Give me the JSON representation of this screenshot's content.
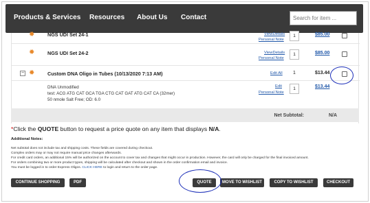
{
  "nav": {
    "items": [
      "Products & Services",
      "Resources",
      "About Us",
      "Contact"
    ],
    "search_placeholder": "Search for item ..."
  },
  "cart": {
    "rows": [
      {
        "name": "NGS UDI Set 24-1",
        "view": "ViewDetails",
        "note": "Personal Note",
        "qty": "1",
        "price": "$85.00"
      },
      {
        "name": "NGS UDI Set 24-2",
        "view": "ViewDetails",
        "note": "Personal Note",
        "qty": "1",
        "price": "$85.00"
      },
      {
        "name": "Custom DNA Oligo in Tubes (10/13/2020 7:13 AM)",
        "edit_all": "Edit All",
        "qty": "1",
        "price": "$13.44"
      }
    ],
    "oligo": {
      "type": "DNA Unmodified",
      "sequence": "test: ACG ATG CAT GCA TGA CTG CAT GAT ATG CAT CA (32mer)",
      "scale": "50 nmole  Salt Free;  OD: 6.0",
      "edit": "Edit",
      "note": "Personal Note",
      "qty": "1",
      "price": "$13.44"
    },
    "net_subtotal_label": "Net Subtotal:",
    "net_subtotal_value": "N/A"
  },
  "quote_note": {
    "star": "*",
    "before": "Click the ",
    "quote": "QUOTE",
    "middle": " button to request a price quote on any item that displays ",
    "na": "N/A",
    "after": "."
  },
  "additional_notes": {
    "title": "Additional Notes:",
    "lines": [
      "Net subtotal does not include tax and shipping costs. These fields are covered during checkout.",
      "Complex orders may or may not require manual price changes afterwards.",
      "For credit card orders, an additional 15% will be authorized on the account to cover tax and changes that might occur in production. However, the card will only be charged for the final invoiced amount.",
      "For orders combining two or more product types, shipping will be calculated after checkout and shown in the order confirmation email and invoice."
    ],
    "last_before": "You must be logged in to order Express Oligos. ",
    "last_link": "CLICK HERE",
    "last_after": " to login and return to the order page."
  },
  "buttons": {
    "continue": "CONTINUE SHOPPING",
    "pdf": "PDF",
    "quote": "QUOTE",
    "move_wishlist": "MOVE TO WISHLIST",
    "copy_wishlist": "COPY TO WISHLIST",
    "checkout": "CHECKOUT"
  },
  "colors": {
    "nav_bg": "#3a3a3a",
    "link": "#1e56a8",
    "gear": "#e8892b",
    "annotation": "#1a2db8",
    "required_star": "#cc0000"
  },
  "icons": [
    "gear-icon",
    "collapse-minus-icon",
    "checkbox-icon"
  ]
}
